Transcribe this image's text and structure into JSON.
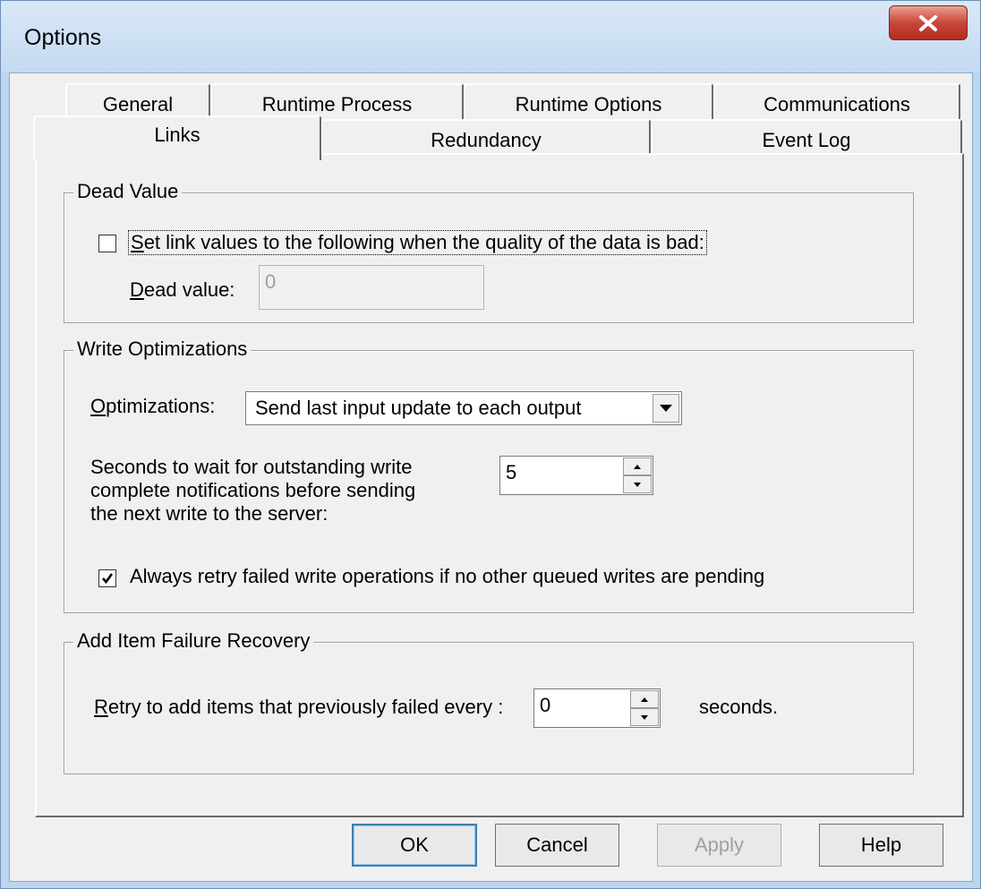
{
  "window": {
    "title": "Options",
    "close_icon": "close-icon"
  },
  "tabs": {
    "row_back": [
      "General",
      "Runtime Process",
      "Runtime Options",
      "Communications"
    ],
    "row_front": [
      "Links",
      "Redundancy",
      "Event Log"
    ],
    "active": "Links"
  },
  "dead_value": {
    "group_title": "Dead Value",
    "checkbox_label": "Set link values to the following when the quality of the data is bad:",
    "checkbox_checked": false,
    "field_label": "Dead value:",
    "field_value": "0"
  },
  "write_opt": {
    "group_title": "Write Optimizations",
    "optimizations_label": "Optimizations:",
    "optimizations_value": "Send last input update to each output",
    "seconds_label_1": "Seconds to wait for outstanding write",
    "seconds_label_2": "complete notifications before sending",
    "seconds_label_3": "the next write to the server:",
    "seconds_value": "5",
    "retry_label": "Always retry failed write operations if no other queued writes are pending",
    "retry_checked": true
  },
  "add_item": {
    "group_title": "Add Item Failure Recovery",
    "retry_label": "Retry to add items that previously failed every :",
    "retry_value": "0",
    "unit_label": "seconds."
  },
  "buttons": {
    "ok": "OK",
    "cancel": "Cancel",
    "apply": "Apply",
    "help": "Help"
  }
}
